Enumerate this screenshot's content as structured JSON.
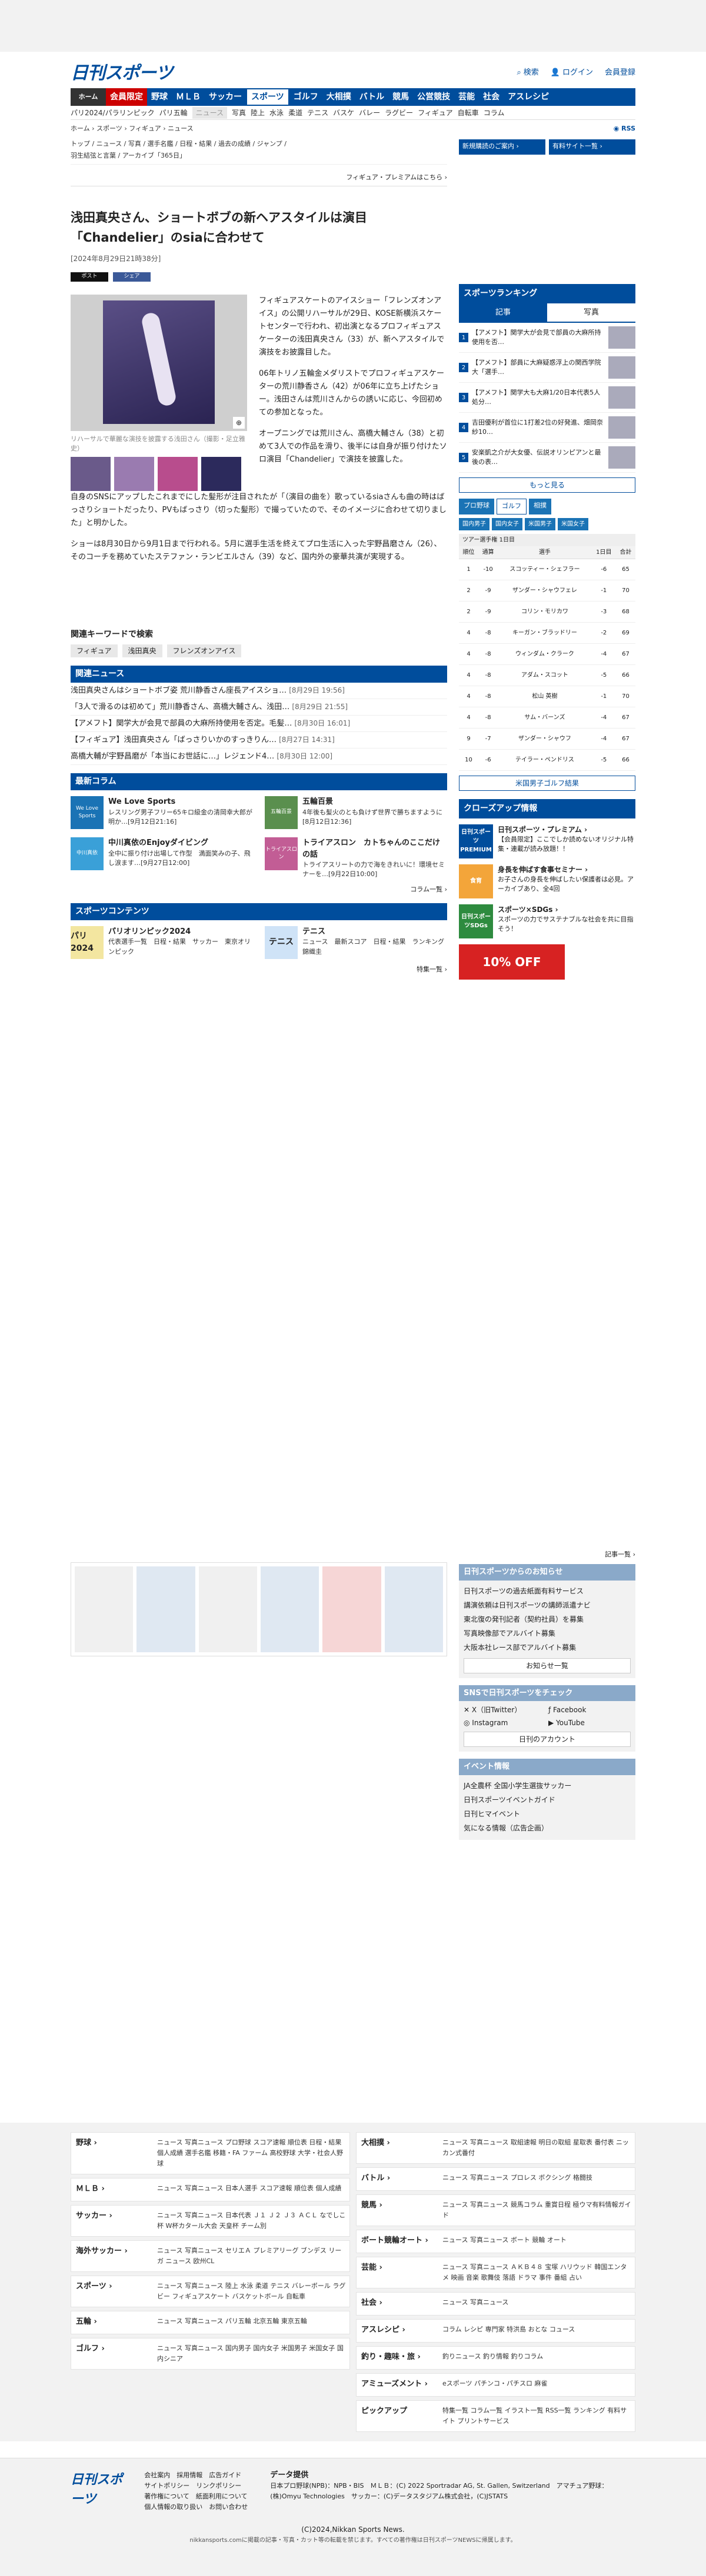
{
  "header": {
    "logo": "日刊スポーツ",
    "search": "検索",
    "login": "ログイン",
    "register": "会員登録"
  },
  "gnav": {
    "home": "ホーム",
    "items": [
      "会員限定",
      "野球",
      "ＭＬＢ",
      "サッカー",
      "スポーツ",
      "ゴルフ",
      "大相撲",
      "バトル",
      "競馬",
      "公営競技",
      "芸能",
      "社会",
      "アスレシピ"
    ]
  },
  "snav": {
    "items": [
      "パリ2024/パラリンピック",
      "パリ五輪",
      "ニュース",
      "写真",
      "陸上",
      "水泳",
      "柔道",
      "テニス",
      "バスケ",
      "バレー",
      "ラグビー",
      "フィギュア",
      "自転車",
      "コラム"
    ]
  },
  "breadcrumb": {
    "path": "ホーム › スポーツ › フィギュア › ニュース",
    "rss": "RSS"
  },
  "secnav": {
    "line1": "トップ / ニュース / 写真 / 選手名鑑 / 日程・結果 / 過去の成績 / ジャンプ /",
    "line2": "羽生結弦と言葉 / アーカイブ「365日」"
  },
  "side_btns": [
    "新規購読のご案内 ›",
    "有料サイト一覧 ›"
  ],
  "premium_link": "フィギュア・プレミアムはこちら ›",
  "article": {
    "title": "浅田真央さん、ショートボブの新ヘアスタイルは演目「Chandelier」のsiaに合わせて",
    "date": "[2024年8月29日21時38分]",
    "share_x": "ポスト",
    "share_fb": "シェア",
    "caption": "リハーサルで華麗な演技を披露する浅田さん（撮影・足立雅史）",
    "paras_right": [
      "フィギュアスケートのアイスショー「フレンズオンアイス」の公開リハーサルが29日、KOSE新横浜スケートセンターで行われ、初出演となるプロフィギュアスケーターの浅田真央さん（33）が、新ヘアスタイルで演技をお披露目した。",
      "06年トリノ五輪金メダリストでプロフィギュアスケーターの荒川静香さん（42）が06年に立ち上げたショー。浅田さんは荒川さんからの誘いに応じ、今回初めての参加となった。",
      "オープニングでは荒川さん、高橋大輔さん（38）と初めて3人での作品を滑り、後半には自身が振り付けたソロ演目「Chandelier」で演技を披露した。"
    ],
    "paras_full": [
      "自身のSNSにアップしたこれまでにした髪形が注目されたが「（演目の曲を）歌っているsiaさんも曲の時はばっさりショートだったり、PVもばっさり（切った髪形）で撮っていたので、そのイメージに合わせて切りました」と明かした。",
      "ショーは8月30日から9月1日まで行われる。5月に選手生活を終えてプロ生活に入った宇野昌磨さん（26）、そのコーチを務めていたステファン・ランビエルさん（39）など、国内外の豪華共演が実現する。"
    ]
  },
  "keywords": {
    "heading": "関連キーワードで検索",
    "items": [
      "フィギュア",
      "浅田真央",
      "フレンズオンアイス"
    ]
  },
  "related": {
    "heading": "関連ニュース",
    "items": [
      {
        "text": "浅田真央さんはショートボブ姿 荒川静香さん座長アイスショ…",
        "date": "[8月29日 19:56]"
      },
      {
        "text": "「3人で滑るのは初めて」荒川静香さん、高橋大輔さん、浅田…",
        "date": "[8月29日 21:55]"
      },
      {
        "text": "【アメフト】関学大が会見で部員の大麻所持使用を否定。毛髪…",
        "date": "[8月30日 16:01]"
      },
      {
        "text": "【フィギュア】浅田真央さん「ばっさりいかのすっきりん…",
        "date": "[8月27日 14:31]"
      },
      {
        "text": "高橋大輔が宇野昌磨が「本当にお世話に…」レジェンド4…",
        "date": "[8月30日 12:00]"
      }
    ]
  },
  "columns": {
    "heading": "最新コラム",
    "items": [
      {
        "icon": "We Love Sports",
        "title": "We Love Sports",
        "desc": "レスリング男子フリー65キロ級金の清岡幸大郎が明か…[9月12日21:16]"
      },
      {
        "icon": "五輪百景",
        "title": "五輪百景",
        "desc": "4年後も髪火のとも負けず世界で勝ちますように[8月12日12:36]"
      },
      {
        "icon": "中川真依",
        "title": "中川真依のEnjoyダイビング",
        "desc": "全中に振り付け出場して作型　満面笑みの子、飛し涙ます…[9月27日12:00]"
      },
      {
        "icon": "トライアスロン",
        "title": "トライアスロン　カトちゃんのここだけの話",
        "desc": "トライアスリートの力で海をきれいに！環境セミナーを…[9月22日10:00]"
      }
    ],
    "more": "コラム一覧 ›"
  },
  "contents": {
    "heading": "スポーツコンテンツ",
    "items": [
      {
        "pic": "パリ 2024",
        "title": "パリオリンピック2024",
        "desc": "代表選手一覧　日程・結果　サッカー　東京オリンピック"
      },
      {
        "pic": "テニス",
        "title": "テニス",
        "desc": "ニュース　最新スコア　日程・結果　ランキング　錦織圭"
      }
    ],
    "more": "特集一覧 ›"
  },
  "ranking": {
    "heading": "スポーツランキング",
    "tabs": [
      "記事",
      "写真"
    ],
    "items": [
      "【アメフト】関学大が会見で部員の大麻所持使用を否…",
      "【アメフト】部員に大麻疑惑浮上の関西学院大「選手…",
      "【アメフト】関学大も大麻1/20日本代表5人処分…",
      "吉田優利が首位に1打差2位の好発進、畑岡奈紗10…",
      "安楽凱之介が大女優、伝説オリンピアンと最後の表…"
    ],
    "more": "もっと見る"
  },
  "golf": {
    "tabs": [
      "プロ野球",
      "ゴルフ",
      "相撲"
    ],
    "subtabs": [
      "国内男子",
      "国内女子",
      "米国男子",
      "米国女子"
    ],
    "tour": "ツアー選手権 1日目",
    "headers": [
      "順位",
      "通算",
      "選手",
      "1日目",
      "合計"
    ],
    "rows": [
      [
        "1",
        "-10",
        "スコッティー・シェフラー",
        "-6",
        "65"
      ],
      [
        "2",
        "-9",
        "ザンダー・シャウフェレ",
        "-1",
        "70"
      ],
      [
        "2",
        "-9",
        "コリン・モリカワ",
        "-3",
        "68"
      ],
      [
        "4",
        "-8",
        "キーガン・ブラッドリー",
        "-2",
        "69"
      ],
      [
        "4",
        "-8",
        "ウィンダム・クラーク",
        "-4",
        "67"
      ],
      [
        "4",
        "-8",
        "アダム・スコット",
        "-5",
        "66"
      ],
      [
        "4",
        "-8",
        "松山 英樹",
        "-1",
        "70"
      ],
      [
        "4",
        "-8",
        "サム・バーンズ",
        "-4",
        "67"
      ],
      [
        "9",
        "-7",
        "ザンダー・シャウフ",
        "-4",
        "67"
      ],
      [
        "10",
        "-6",
        "テイラー・ペンドリス",
        "-5",
        "66"
      ]
    ],
    "more": "米国男子ゴルフ結果"
  },
  "closeup": {
    "heading": "クローズアップ情報",
    "items": [
      {
        "icon": "日刊スポーツ PREMIUM",
        "title": "日刊スポーツ・プレミアム ›",
        "desc": "【会員限定】ここでしか読めないオリジナル特集・連載が読み放題！！"
      },
      {
        "icon": "食育",
        "title": "身長を伸ばす食事セミナー ›",
        "desc": "お子さんの身長を伸ばしたい保護者は必見。アーカイブあり、全4回"
      },
      {
        "icon": "日刊スポーツSDGs",
        "title": "スポーツ×SDGs ›",
        "desc": "スポーツの力でサステナブルな社会を共に目指そう！"
      }
    ],
    "ad": "10% OFF"
  },
  "notice": {
    "more": "記事一覧 ›",
    "heading": "日刊スポーツからのお知らせ",
    "items": [
      "日刊スポーツの過去紙面有料サービス",
      "講演依頼は日刊スポーツの講師派遣ナビ",
      "東北復の発刊記者（契約社員）を募集",
      "写真映像部でアルバイト募集",
      "大阪本社レース部でアルバイト募集"
    ],
    "btn": "お知らせ一覧"
  },
  "sns": {
    "heading": "SNSで日刊スポーツをチェック",
    "x": "X（旧Twitter）",
    "fb": "Facebook",
    "ig": "Instagram",
    "yt": "YouTube",
    "btn": "日刊のアカウント"
  },
  "events": {
    "heading": "イベント情報",
    "items": [
      "JA全農杯 全国小学生選抜サッカー",
      "日刊スポーツイベントガイド",
      "日刊ヒマイベント",
      "気になる情報（広告企画）"
    ]
  },
  "footer": {
    "left": [
      {
        "k": "野球 ›",
        "v": "ニュース 写真ニュース プロ野球 スコア速報 順位表 日程・結果 個人成績 選手名鑑 移籍・FA ファーム 高校野球 大学・社会人野球"
      },
      {
        "k": "ＭＬＢ ›",
        "v": "ニュース 写真ニュース 日本人選手 スコア速報 順位表 個人成績"
      },
      {
        "k": "サッカー ›",
        "v": "ニュース 写真ニュース 日本代表 Ｊ１ Ｊ２ Ｊ３ ＡＣＬ なでしこ杯 W杯カタール大会 天皇杯 チーム別"
      },
      {
        "k": "海外サッカー ›",
        "v": "ニュース 写真ニュース セリエＡ プレミアリーグ ブンデス リーガ ニュース 欧州CL"
      },
      {
        "k": "スポーツ ›",
        "v": "ニュース 写真ニュース 陸上 水泳 柔道 テニス バレーボール ラグビー フィギュアスケート バスケットボール 自転車"
      },
      {
        "k": "五輪 ›",
        "v": "ニュース 写真ニュース パリ五輪 北京五輪 東京五輪"
      },
      {
        "k": "ゴルフ ›",
        "v": "ニュース 写真ニュース 国内男子 国内女子 米国男子 米国女子 国内シニア"
      }
    ],
    "right": [
      {
        "k": "大相撲 ›",
        "v": "ニュース 写真ニュース 取組速報 明日の取組 星取表 番付表 ニッカン式番付"
      },
      {
        "k": "バトル ›",
        "v": "ニュース 写真ニュース プロレス ボクシング 格闘技"
      },
      {
        "k": "競馬 ›",
        "v": "ニュース 写真ニュース 競馬コラム 重賞日程 極ウマ有料情報ガイド"
      },
      {
        "k": "ボート競輪オート ›",
        "v": "ニュース 写真ニュース ボート 競輪 オート"
      },
      {
        "k": "芸能 ›",
        "v": "ニュース 写真ニュース ＡＫＢ４８ 宝塚 ハリウッド 韓国エンタメ 映画 音楽 歌舞伎 落語 ドラマ 事件 番組 占い"
      },
      {
        "k": "社会 ›",
        "v": "ニュース 写真ニュース"
      },
      {
        "k": "アスレシピ ›",
        "v": "コラム レシピ 専門家 特洪島 おとな コュース"
      },
      {
        "k": "釣り・趣味・旅 ›",
        "v": "釣りニュース 釣り情報 釣りコラム"
      },
      {
        "k": "アミューズメント ›",
        "v": "eスポーツ パチンコ・パチスロ 麻雀"
      },
      {
        "k": "ピックアップ",
        "v": "特集一覧 コラム一覧 イラスト一覧 RSS一覧 ランキング 有料サイト プリントサービス"
      }
    ],
    "logo": "日刊スポーツ",
    "links": "会社案内　採用情報　広告ガイド　サイトポリシー　リンクポリシー　著作権について　紙面利用について　個人情報の取り扱い　お問い合わせ",
    "data_h": "データ提供",
    "data": "日本プロ野球(NPB)：NPB・BIS　ＭＬＢ：(C) 2022 Sportradar AG, St. Gallen, Switzerland　アマチュア野球：(株)Omyu Technologies　サッカー：(C)データスタジアム株式会社，(C)JSTATS",
    "copyright": "(C)2024,Nikkan Sports News.",
    "note": "nikkansports.comに掲載の記事・写真・カット等の転載を禁じます。すべての著作権は日刊スポーツNEWSに帰属します。"
  }
}
